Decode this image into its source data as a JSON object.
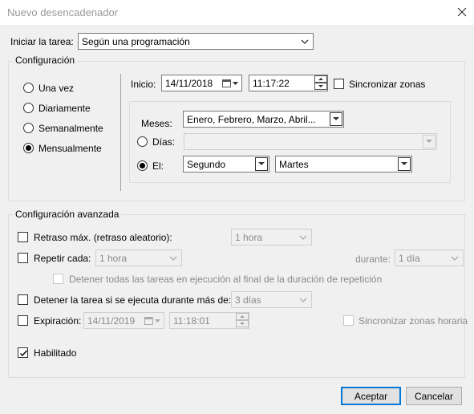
{
  "window": {
    "title": "Nuevo desencadenador"
  },
  "start_task": {
    "label": "Iniciar la tarea:",
    "value": "Según una programación"
  },
  "config": {
    "group_label": "Configuración",
    "options": [
      "Una vez",
      "Diariamente",
      "Semanalmente",
      "Mensualmente"
    ],
    "selected": "Mensualmente",
    "start_label": "Inicio:",
    "start_date": "14/11/2018",
    "start_time": "11:17:22",
    "sync_label": "Sincronizar zonas",
    "months_label": "Meses:",
    "months_value": "Enero, Febrero, Marzo, Abril...",
    "days_label": "Días:",
    "days_value": "",
    "on_label": "El:",
    "on_week": "Segundo",
    "on_day": "Martes"
  },
  "advanced": {
    "group_label": "Configuración avanzada",
    "delay_label": "Retraso máx. (retraso aleatorio):",
    "delay_value": "1 hora",
    "repeat_label": "Repetir cada:",
    "repeat_value": "1 hora",
    "duration_label": "durante:",
    "duration_value": "1 día",
    "stop_all_label": "Detener todas las tareas en ejecución al final de la duración de repetición",
    "stop_task_label": "Detener la tarea si se ejecuta durante más de:",
    "stop_task_value": "3 días",
    "expire_label": "Expiración:",
    "expire_date": "14/11/2019",
    "expire_time": "11:18:01",
    "expire_sync_label": "Sincronizar zonas horaria",
    "enabled_label": "Habilitado"
  },
  "buttons": {
    "accept": "Aceptar",
    "cancel": "Cancelar"
  }
}
